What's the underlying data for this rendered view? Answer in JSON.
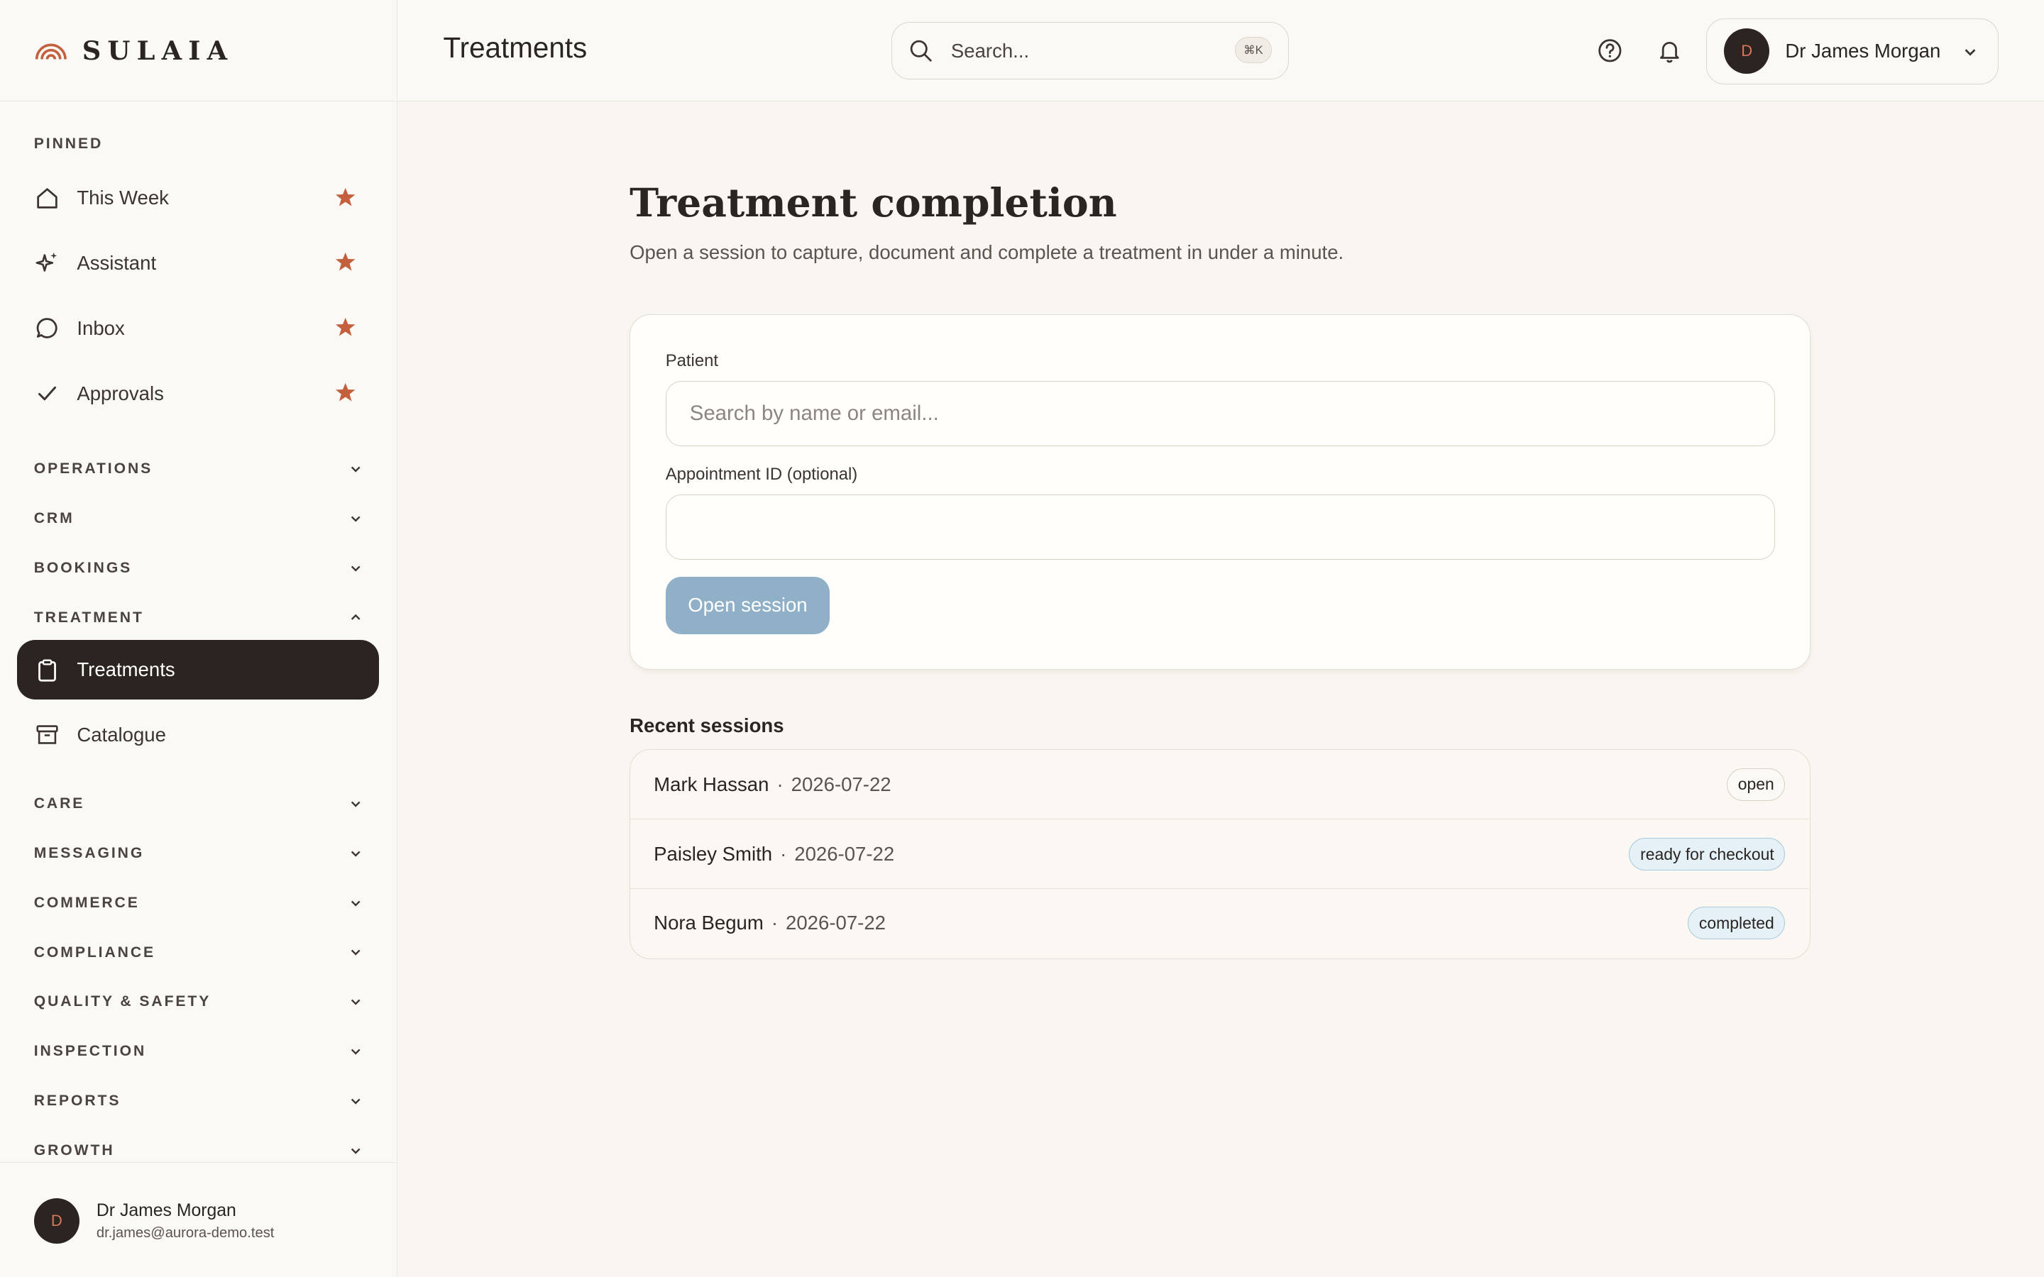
{
  "brand": {
    "name": "SULAIA",
    "accent": "#c5603f"
  },
  "sidebar": {
    "pinned_label": "PINNED",
    "pinned": [
      {
        "label": "This Week",
        "icon": "home-icon"
      },
      {
        "label": "Assistant",
        "icon": "sparkles-icon"
      },
      {
        "label": "Inbox",
        "icon": "chat-bubble-icon"
      },
      {
        "label": "Approvals",
        "icon": "check-icon"
      }
    ],
    "groups": {
      "operations": "OPERATIONS",
      "crm": "CRM",
      "bookings": "BOOKINGS",
      "treatment": "TREATMENT",
      "care": "CARE",
      "messaging": "MESSAGING",
      "commerce": "COMMERCE",
      "compliance": "COMPLIANCE",
      "quality": "QUALITY & SAFETY",
      "inspection": "INSPECTION",
      "reports": "REPORTS",
      "growth": "GROWTH"
    },
    "treatment_items": [
      {
        "label": "Treatments",
        "icon": "clipboard-icon",
        "active": true
      },
      {
        "label": "Catalogue",
        "icon": "archive-box-icon",
        "active": false
      }
    ],
    "footer": {
      "avatar_initial": "D",
      "name": "Dr James Morgan",
      "email": "dr.james@aurora-demo.test"
    }
  },
  "topbar": {
    "title": "Treatments",
    "search_placeholder": "Search...",
    "search_shortcut": "⌘K",
    "user": {
      "avatar_initial": "D",
      "name": "Dr James Morgan"
    }
  },
  "main": {
    "title": "Treatment completion",
    "subtitle": "Open a session to capture, document and complete a treatment in under a minute.",
    "form": {
      "patient_label": "Patient",
      "patient_placeholder": "Search by name or email...",
      "patient_value": "",
      "appointment_label": "Appointment ID (optional)",
      "appointment_value": "",
      "open_button": "Open session"
    },
    "recent_title": "Recent sessions",
    "sessions": [
      {
        "name": "Mark Hassan",
        "separator": "·",
        "date": "2026-07-22",
        "status": "open"
      },
      {
        "name": "Paisley Smith",
        "separator": "·",
        "date": "2026-07-22",
        "status": "ready for checkout"
      },
      {
        "name": "Nora Begum",
        "separator": "·",
        "date": "2026-07-22",
        "status": "completed"
      }
    ]
  },
  "colors": {
    "background": "#f9f6f1",
    "sidebar_active": "#2b2420",
    "button_primary_disabled": "#8fb0c6",
    "star": "#c5603f"
  }
}
